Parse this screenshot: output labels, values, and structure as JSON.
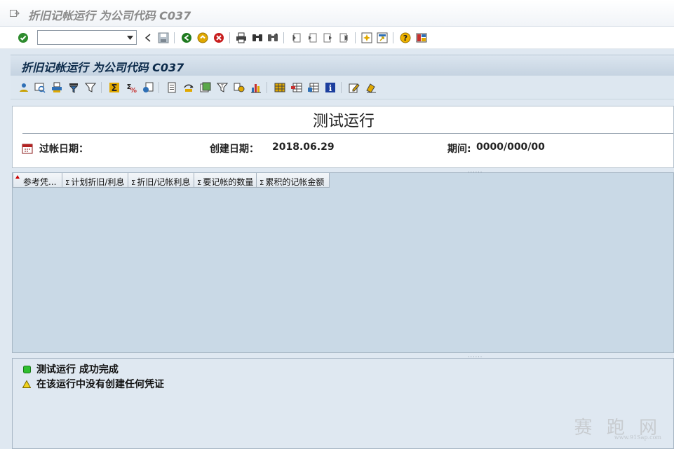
{
  "window": {
    "title": "折旧记帐运行 为公司代码 C037"
  },
  "system_toolbar": {
    "command_field": {
      "value": "",
      "placeholder": ""
    },
    "buttons": [
      {
        "name": "enter-icon",
        "color": "#2e8b2e"
      },
      {
        "name": "back-icon",
        "color": "#1f7a1f"
      },
      {
        "name": "exit-icon",
        "color": "#d29c00"
      },
      {
        "name": "cancel-icon",
        "color": "#c81e1e"
      },
      {
        "name": "print-icon",
        "color": "#333333"
      },
      {
        "name": "find-icon",
        "color": "#333333"
      },
      {
        "name": "find-next-icon",
        "color": "#333333"
      },
      {
        "name": "first-page-icon",
        "color": "#666666"
      },
      {
        "name": "previous-page-icon",
        "color": "#666666"
      },
      {
        "name": "next-page-icon",
        "color": "#666666"
      },
      {
        "name": "last-page-icon",
        "color": "#666666"
      },
      {
        "name": "create-session-icon",
        "color": "#c8a000"
      },
      {
        "name": "shortcut-icon",
        "color": "#c8a000"
      },
      {
        "name": "help-icon",
        "color": "#d29c00"
      },
      {
        "name": "customize-layout-icon",
        "color": "#2e6fb5"
      }
    ]
  },
  "screen": {
    "title": "折旧记帐运行 为公司代码 C037"
  },
  "app_toolbar": {
    "buttons": [
      "details-icon",
      "select-detail-icon",
      "print-preview-icon",
      "filter-icon",
      "set-filter-icon",
      "sum-icon",
      "subtotal-icon",
      "export-icon",
      "local-file-icon",
      "sort-ascending-icon",
      "sort-descending-icon",
      "find-icon",
      "abc-analysis-icon",
      "graphic-icon",
      "layout-icon",
      "change-layout-icon",
      "save-layout-icon",
      "information-icon",
      "edit-icon",
      "delete-icon"
    ]
  },
  "header": {
    "title": "测试运行",
    "posting_date_label": "过帐日期：",
    "created_date_label": "创建日期：",
    "created_date_value": "2018.06.29",
    "period_label": "期间:",
    "period_value": "0000/000/00"
  },
  "grid": {
    "columns": [
      {
        "label": "参考凭...",
        "sigma": false
      },
      {
        "label": "计划折旧/利息",
        "sigma": true
      },
      {
        "label": "折旧/记帐利息",
        "sigma": true
      },
      {
        "label": "要记帐的数量",
        "sigma": true
      },
      {
        "label": "累积的记帐金额",
        "sigma": true
      }
    ],
    "rows": []
  },
  "messages": [
    {
      "type": "success",
      "color": "#2fbf2f",
      "text": "测试运行  成功完成"
    },
    {
      "type": "warning",
      "color": "#f1d21c",
      "text": "在该运行中没有创建任何凭证"
    }
  ],
  "watermark": {
    "text": "赛 跑 网",
    "url": "www.91Sap.com"
  }
}
